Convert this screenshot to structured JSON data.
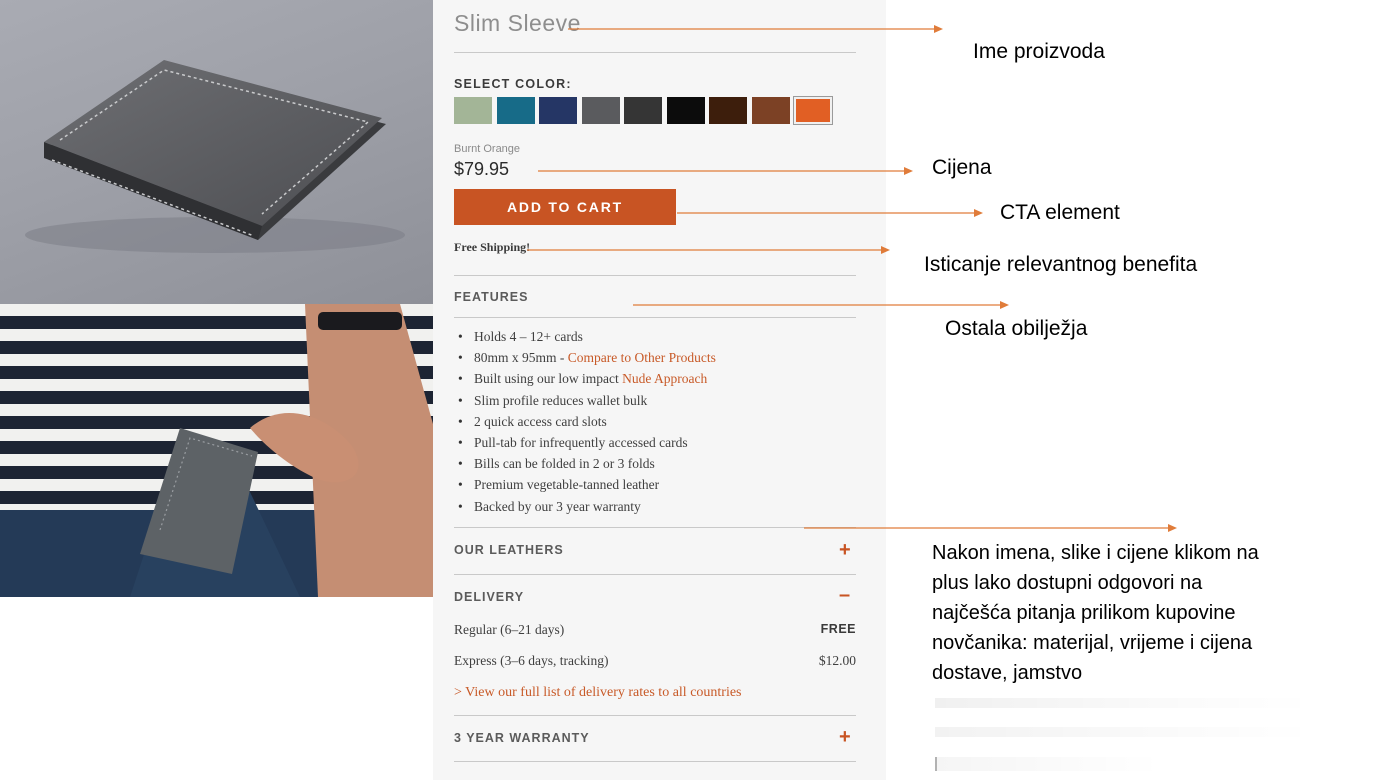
{
  "product": {
    "name": "Slim Sleeve",
    "select_color_label": "SELECT COLOR:",
    "swatches": [
      {
        "name": "sage",
        "color": "#a3b597"
      },
      {
        "name": "teal",
        "color": "#176b88"
      },
      {
        "name": "navy",
        "color": "#253665"
      },
      {
        "name": "charcoal",
        "color": "#5a5b5e"
      },
      {
        "name": "black-grey",
        "color": "#353535"
      },
      {
        "name": "black",
        "color": "#0c0c0c"
      },
      {
        "name": "dark-brown",
        "color": "#3d1e0c"
      },
      {
        "name": "tan",
        "color": "#7c4125"
      },
      {
        "name": "burnt-orange",
        "color": "#e15f24",
        "selected": true
      }
    ],
    "selected_color": "Burnt Orange",
    "price": "$79.95",
    "cta_label": "ADD TO CART",
    "benefit": "Free Shipping!",
    "accent_color": "#c85423"
  },
  "features": {
    "heading": "FEATURES",
    "items": [
      {
        "text": "Holds 4 – 12+ cards"
      },
      {
        "text": "80mm x 95mm - ",
        "link": "Compare to Other Products"
      },
      {
        "text": "Built using our low impact ",
        "link": "Nude Approach"
      },
      {
        "text": "Slim profile reduces wallet bulk"
      },
      {
        "text": "2 quick access card slots"
      },
      {
        "text": "Pull-tab for infrequently accessed cards"
      },
      {
        "text": "Bills can be folded in 2 or 3 folds"
      },
      {
        "text": "Premium vegetable-tanned leather"
      },
      {
        "text": "Backed by our 3 year warranty"
      }
    ]
  },
  "accordions": {
    "leathers": {
      "heading": "OUR LEATHERS",
      "icon": "+"
    },
    "delivery": {
      "heading": "DELIVERY",
      "icon": "–",
      "rows": [
        {
          "label": "Regular (6–21 days)",
          "value": "FREE"
        },
        {
          "label": "Express (3–6 days, tracking)",
          "value": "$12.00"
        }
      ],
      "link": "> View our full list of delivery rates to all countries"
    },
    "warranty": {
      "heading": "3 YEAR WARRANTY",
      "icon": "+"
    }
  },
  "annotations": {
    "arrow_color": "#e07c3a",
    "name_note": "Ime proizvoda",
    "price_note": "Cijena",
    "cta_note": "CTA element",
    "benefit_note": "Isticanje relevantnog benefita",
    "features_note": "Ostala obilježja",
    "faq_note_lines": [
      "Nakon imena, slike i cijene klikom na",
      "plus lako dostupni odgovori na",
      "najčešća pitanja prilikom kupovine",
      "novčanika: materijal, vrijeme i cijena",
      "dostave, jamstvo"
    ]
  }
}
